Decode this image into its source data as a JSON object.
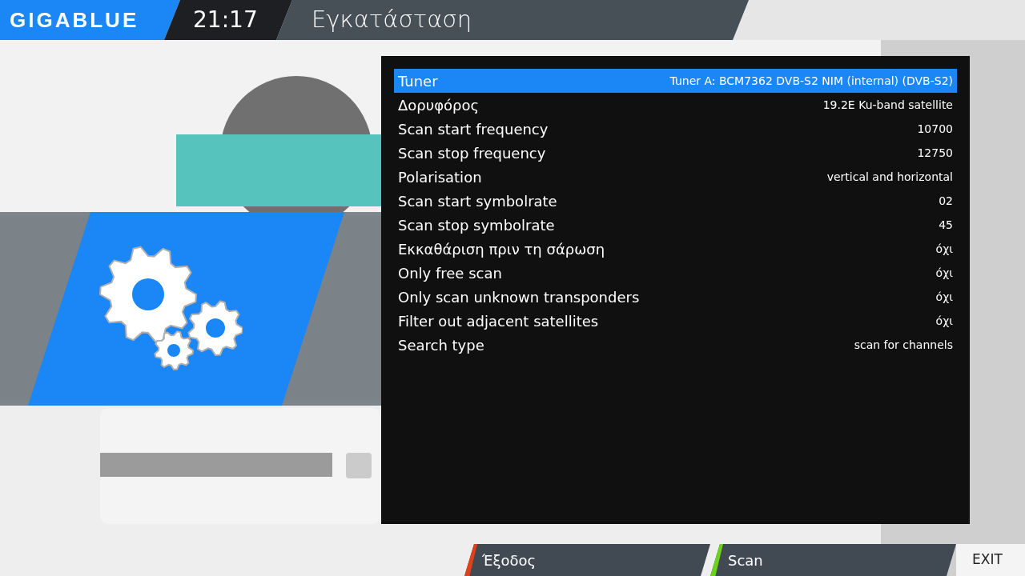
{
  "header": {
    "logo": "GIGABLUE",
    "clock": "21:17",
    "title": "Εγκατάσταση"
  },
  "menu": [
    {
      "label": "Tuner",
      "value": "Tuner A: BCM7362 DVB-S2 NIM (internal) (DVB-S2)",
      "selected": true
    },
    {
      "label": "Δορυφόρος",
      "value": "19.2E Ku-band satellite",
      "selected": false
    },
    {
      "label": "Scan start frequency",
      "value": "10700",
      "selected": false
    },
    {
      "label": "Scan stop frequency",
      "value": "12750",
      "selected": false
    },
    {
      "label": "Polarisation",
      "value": "vertical and horizontal",
      "selected": false
    },
    {
      "label": "Scan start symbolrate",
      "value": "02",
      "selected": false
    },
    {
      "label": "Scan stop symbolrate",
      "value": "45",
      "selected": false
    },
    {
      "label": "Εκκαθάριση πριν τη σάρωση",
      "value": "όχι",
      "selected": false
    },
    {
      "label": "Only free scan",
      "value": "όχι",
      "selected": false
    },
    {
      "label": "Only scan unknown transponders",
      "value": "όχι",
      "selected": false
    },
    {
      "label": "Filter out adjacent satellites",
      "value": "όχι",
      "selected": false
    },
    {
      "label": "Search type",
      "value": "scan for channels",
      "selected": false
    }
  ],
  "buttons": [
    {
      "label": "Έξοδος",
      "color": "#e0401a"
    },
    {
      "label": "Scan",
      "color": "#6cd21e"
    }
  ],
  "exit_key": "EXIT"
}
